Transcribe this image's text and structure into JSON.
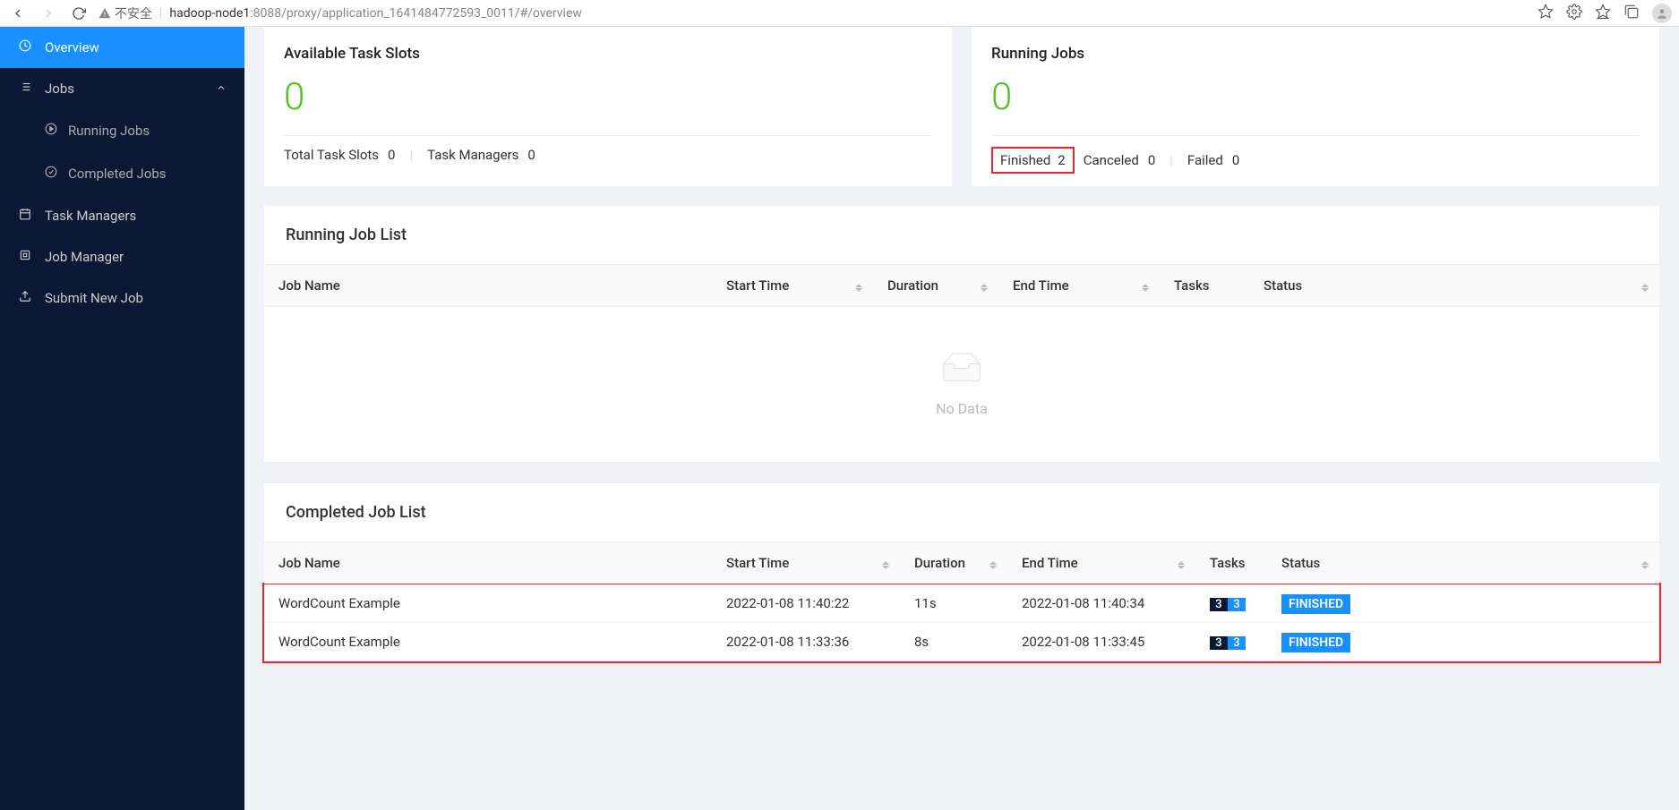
{
  "browser": {
    "insecure_label": "不安全",
    "url_host": "hadoop-node1",
    "url_rest": ":8088/proxy/application_1641484772593_0011/#/overview"
  },
  "sidebar": {
    "overview": "Overview",
    "jobs": "Jobs",
    "running_jobs": "Running Jobs",
    "completed_jobs": "Completed Jobs",
    "task_managers": "Task Managers",
    "job_manager": "Job Manager",
    "submit_new_job": "Submit New Job"
  },
  "slots_card": {
    "title": "Available Task Slots",
    "value": "0",
    "total_label": "Total Task Slots",
    "total_value": "0",
    "tm_label": "Task Managers",
    "tm_value": "0"
  },
  "jobs_card": {
    "title": "Running Jobs",
    "value": "0",
    "finished_label": "Finished",
    "finished_value": "2",
    "canceled_label": "Canceled",
    "canceled_value": "0",
    "failed_label": "Failed",
    "failed_value": "0"
  },
  "running_list": {
    "title": "Running Job List",
    "headers": {
      "job_name": "Job Name",
      "start_time": "Start Time",
      "duration": "Duration",
      "end_time": "End Time",
      "tasks": "Tasks",
      "status": "Status"
    },
    "empty": "No Data"
  },
  "completed_list": {
    "title": "Completed Job List",
    "headers": {
      "job_name": "Job Name",
      "start_time": "Start Time",
      "duration": "Duration",
      "end_time": "End Time",
      "tasks": "Tasks",
      "status": "Status"
    },
    "rows": [
      {
        "name": "WordCount Example",
        "start": "2022-01-08 11:40:22",
        "duration": "11s",
        "end": "2022-01-08 11:40:34",
        "t1": "3",
        "t2": "3",
        "status": "FINISHED"
      },
      {
        "name": "WordCount Example",
        "start": "2022-01-08 11:33:36",
        "duration": "8s",
        "end": "2022-01-08 11:33:45",
        "t1": "3",
        "t2": "3",
        "status": "FINISHED"
      }
    ]
  }
}
